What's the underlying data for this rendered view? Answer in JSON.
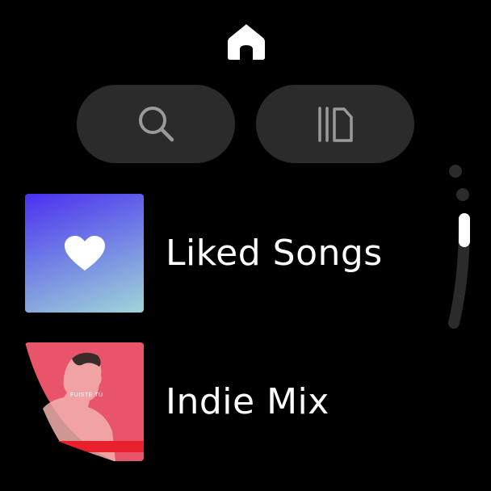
{
  "header": {
    "icon": "home-icon"
  },
  "toolbar": {
    "search_icon": "search-icon",
    "library_icon": "library-icon"
  },
  "list": {
    "items": [
      {
        "label": "Liked Songs",
        "icon": "heart-icon",
        "art_colors": [
          "#4a30f0",
          "#9fd6d8"
        ]
      },
      {
        "label": "Indie Mix",
        "cover_caption": "FUISTE TÚ",
        "art_color": "#e8546a"
      }
    ]
  },
  "scroll": {
    "position": 0.35
  }
}
